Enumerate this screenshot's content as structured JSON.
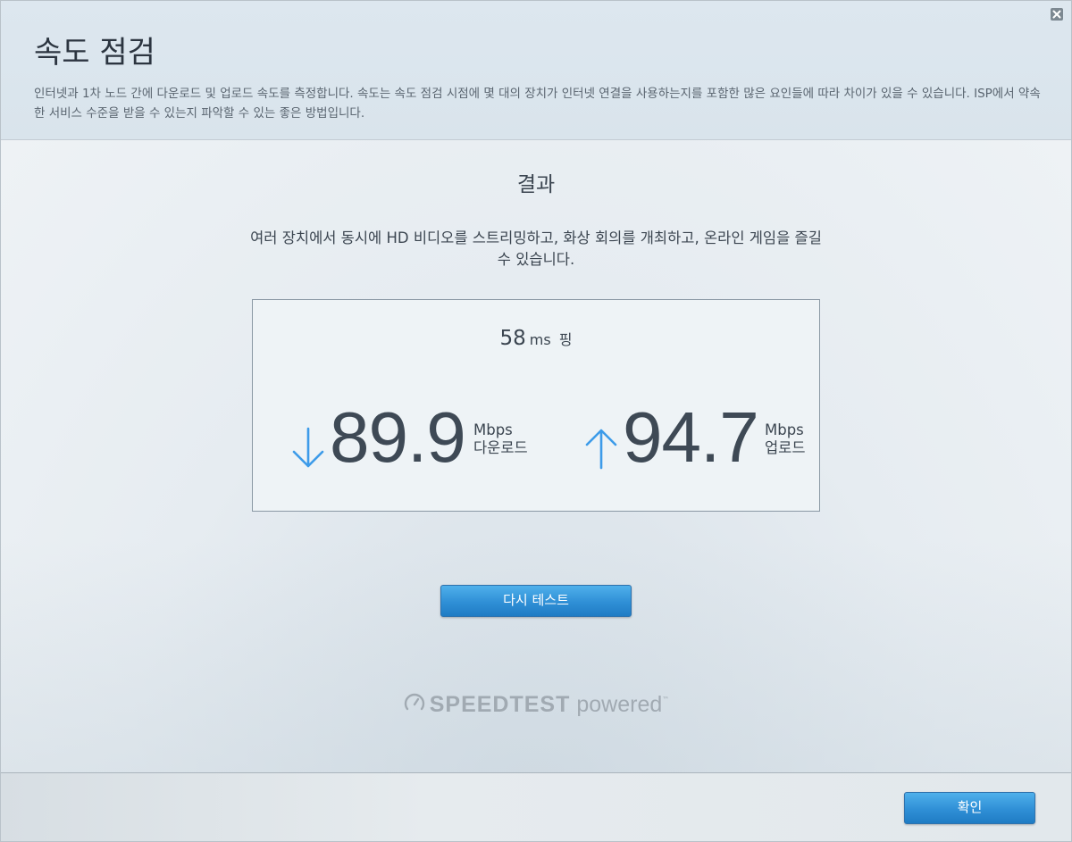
{
  "header": {
    "title": "속도 점검",
    "description": "인터넷과 1차 노드 간에 다운로드 및 업로드 속도를 측정합니다. 속도는 속도 점검 시점에 몇 대의 장치가 인터넷 연결을 사용하는지를 포함한 많은 요인들에 따라 차이가 있을 수 있습니다. ISP에서 약속한 서비스 수준을 받을 수 있는지 파악할 수 있는 좋은 방법입니다.",
    "close_icon": "close-icon"
  },
  "results": {
    "heading": "결과",
    "message": "여러 장치에서 동시에 HD 비디오를 스트리밍하고, 화상 회의를 개최하고, 온라인 게임을 즐길 수 있습니다.",
    "ping": {
      "value": "58",
      "unit": "ms",
      "label": "핑"
    },
    "download": {
      "value": "89.9",
      "unit": "Mbps",
      "label": "다운로드",
      "icon": "arrow-down-icon"
    },
    "upload": {
      "value": "94.7",
      "unit": "Mbps",
      "label": "업로드",
      "icon": "arrow-up-icon"
    },
    "retest_label": "다시 테스트"
  },
  "branding": {
    "brand": "SPEEDTEST",
    "suffix": "powered",
    "trademark": "™",
    "icon": "speedometer-icon"
  },
  "footer": {
    "ok_label": "확인"
  },
  "colors": {
    "accent_button": "#2f8fd6",
    "arrow": "#3d9be9",
    "text_dark": "#3b4550"
  }
}
